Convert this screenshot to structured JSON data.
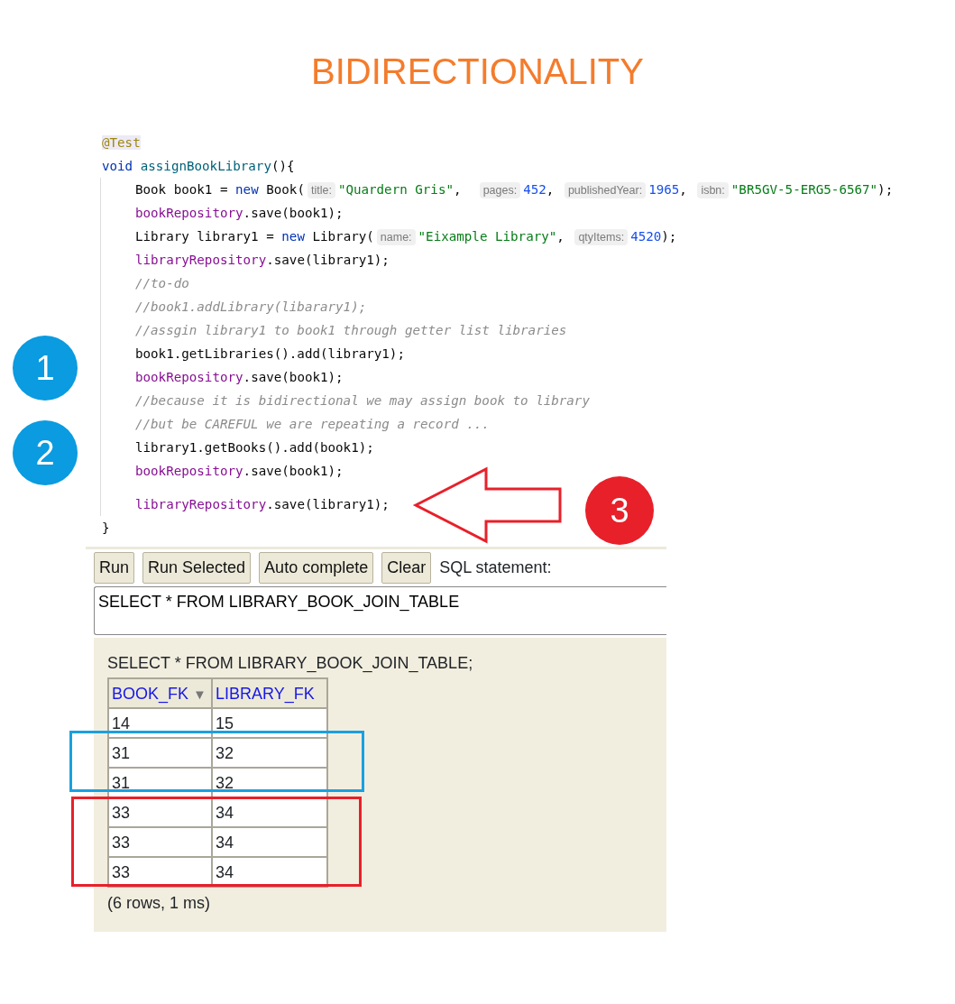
{
  "title": "BIDIRECTIONALITY",
  "code": {
    "head": [
      [
        {
          "kind": "annotation",
          "text": "@Test"
        }
      ],
      [
        {
          "kind": "keyword",
          "text": "void "
        },
        {
          "kind": "method",
          "text": "assignBookLibrary"
        },
        {
          "kind": "plain",
          "text": "(){"
        }
      ]
    ],
    "body": [
      [
        {
          "kind": "plain",
          "text": "Book book1 = "
        },
        {
          "kind": "keyword",
          "text": "new "
        },
        {
          "kind": "plain",
          "text": "Book("
        },
        {
          "kind": "hint",
          "text": "title:"
        },
        {
          "kind": "string",
          "text": "\"Quardern Gris\""
        },
        {
          "kind": "plain",
          "text": ",  "
        },
        {
          "kind": "hint",
          "text": "pages:"
        },
        {
          "kind": "number",
          "text": "452"
        },
        {
          "kind": "plain",
          "text": ", "
        },
        {
          "kind": "hint",
          "text": "publishedYear:"
        },
        {
          "kind": "number",
          "text": "1965"
        },
        {
          "kind": "plain",
          "text": ", "
        },
        {
          "kind": "hint",
          "text": "isbn:"
        },
        {
          "kind": "string",
          "text": "\"BR5GV-5-ERG5-6567\""
        },
        {
          "kind": "plain",
          "text": ");"
        }
      ],
      [
        {
          "kind": "field",
          "text": "bookRepository"
        },
        {
          "kind": "plain",
          "text": ".save(book1);"
        }
      ],
      [
        {
          "kind": "plain",
          "text": "Library library1 = "
        },
        {
          "kind": "keyword",
          "text": "new "
        },
        {
          "kind": "plain",
          "text": "Library("
        },
        {
          "kind": "hint",
          "text": "name:"
        },
        {
          "kind": "string",
          "text": "\"Eixample Library\""
        },
        {
          "kind": "plain",
          "text": ", "
        },
        {
          "kind": "hint",
          "text": "qtyItems:"
        },
        {
          "kind": "number",
          "text": "4520"
        },
        {
          "kind": "plain",
          "text": ");"
        }
      ],
      [
        {
          "kind": "field",
          "text": "libraryRepository"
        },
        {
          "kind": "plain",
          "text": ".save(library1);"
        }
      ],
      [
        {
          "kind": "comment",
          "text": "//to-do"
        }
      ],
      [
        {
          "kind": "comment",
          "text": "//book1.addLibrary(libarary1);"
        }
      ],
      [
        {
          "kind": "comment",
          "text": "//assgin library1 to book1 through getter list libraries"
        }
      ],
      [
        {
          "kind": "plain",
          "text": "book1.getLibraries().add(library1);"
        }
      ],
      [
        {
          "kind": "field",
          "text": "bookRepository"
        },
        {
          "kind": "plain",
          "text": ".save(book1);"
        }
      ],
      [
        {
          "kind": "comment",
          "text": "//because it is bidirectional we may assign book to library"
        }
      ],
      [
        {
          "kind": "comment",
          "text": "//but be CAREFUL we are repeating a record ..."
        }
      ],
      [
        {
          "kind": "plain",
          "text": "library1.getBooks().add(book1);"
        }
      ],
      [
        {
          "kind": "field",
          "text": "bookRepository"
        },
        {
          "kind": "plain",
          "text": ".save(book1);"
        }
      ],
      [
        {
          "kind": "field",
          "text": "libraryRepository"
        },
        {
          "kind": "plain",
          "text": ".save(library1);"
        }
      ]
    ],
    "tail": [
      [
        {
          "kind": "plain",
          "text": "}"
        }
      ]
    ]
  },
  "sql_console": {
    "buttons": [
      "Run",
      "Run Selected",
      "Auto complete",
      "Clear"
    ],
    "label": "SQL statement:",
    "statement": "SELECT * FROM LIBRARY_BOOK_JOIN_TABLE",
    "result": {
      "query": "SELECT * FROM LIBRARY_BOOK_JOIN_TABLE;",
      "columns": [
        {
          "label": "BOOK_FK",
          "sort_indicator": "▼"
        },
        {
          "label": "LIBRARY_FK"
        }
      ],
      "rows": [
        [
          "14",
          "15"
        ],
        [
          "31",
          "32"
        ],
        [
          "31",
          "32"
        ],
        [
          "33",
          "34"
        ],
        [
          "33",
          "34"
        ],
        [
          "33",
          "34"
        ]
      ],
      "footer": "(6 rows, 1 ms)"
    }
  },
  "markers": [
    {
      "label": "1",
      "color": "#0a9be0"
    },
    {
      "label": "2",
      "color": "#0a9be0"
    },
    {
      "label": "3",
      "color": "#e8202a"
    }
  ],
  "highlights": [
    {
      "color": "#1aa0e0"
    },
    {
      "color": "#e8202a"
    }
  ]
}
